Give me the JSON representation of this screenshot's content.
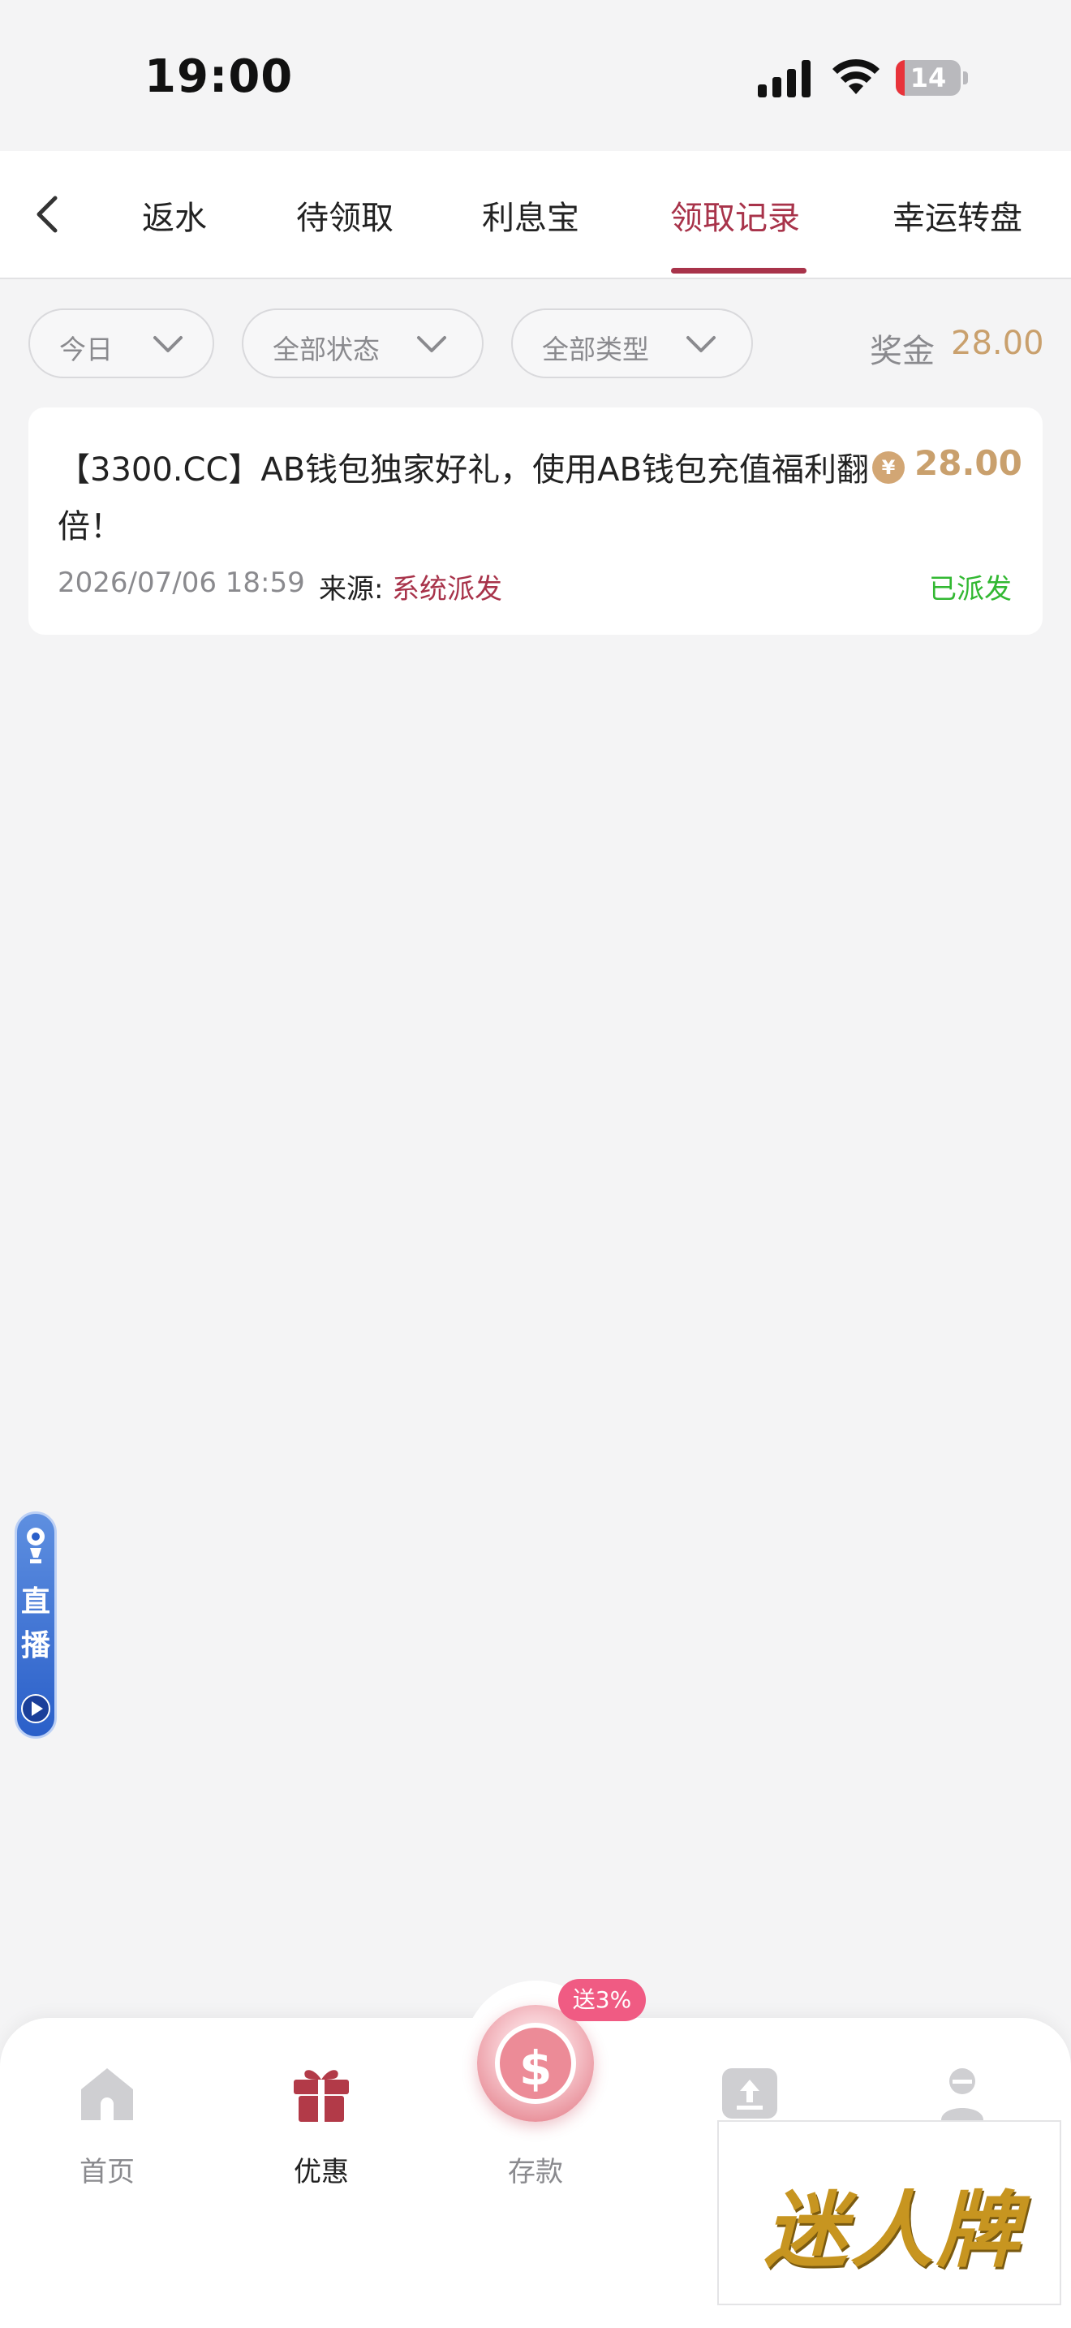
{
  "status_bar": {
    "time": "19:00",
    "battery": "14",
    "battery_level": 0.14
  },
  "tabs": {
    "items": [
      "返水",
      "待领取",
      "利息宝",
      "领取记录",
      "幸运转盘"
    ],
    "active": "领取记录"
  },
  "filters": {
    "date": "今日",
    "status": "全部状态",
    "type": "全部类型"
  },
  "summary": {
    "bonus_label": "奖金",
    "bonus_value": "28.00"
  },
  "record": {
    "title": "【3300.CC】AB钱包独家好礼，使用AB钱包充值福利翻倍！",
    "coin_symbol": "¥",
    "amount": "28.00",
    "datetime": "2026/07/06 18:59",
    "source_label": "来源:",
    "source_value": "系统派发",
    "status": "已派发"
  },
  "live_float": {
    "label": "直播"
  },
  "bottom_nav": {
    "home": "首页",
    "promo": "优惠",
    "deposit": "存款",
    "deposit_badge": "送3%"
  },
  "watermark": {
    "text": "迷人牌"
  },
  "colors": {
    "accent": "#a8334a",
    "gold": "#c9a06d",
    "success": "#32b832",
    "badge": "#f05b83"
  }
}
